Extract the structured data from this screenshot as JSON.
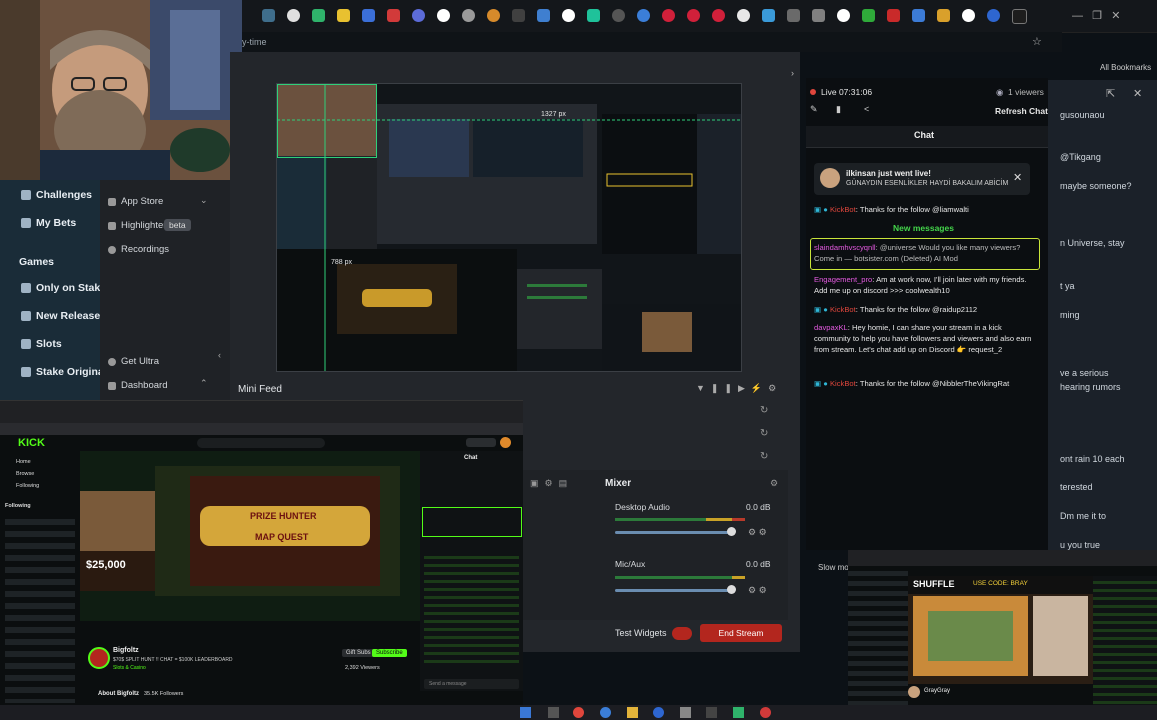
{
  "browser": {
    "url_fragment": "y-time",
    "all_bookmarks": "All Bookmarks"
  },
  "stake": {
    "challenges": "Challenges",
    "my_bets": "My Bets",
    "games": "Games",
    "only_on_stake": "Only on Stake",
    "new_releases": "New Releases",
    "slots": "Slots",
    "stake_originals": "Stake Originals"
  },
  "docks": {
    "app_store": "App Store",
    "highlighter": "Highlighter",
    "beta": "beta",
    "recordings": "Recordings",
    "get_ultra": "Get Ultra",
    "dashboard": "Dashboard"
  },
  "obs": {
    "preview_size_w": "1327 px",
    "preview_size_h": "788 px",
    "mini_feed": "Mini Feed",
    "mixer": "Mixer",
    "desktop_audio": "Desktop Audio",
    "desktop_db": "0.0 dB",
    "mic_aux": "Mic/Aux",
    "mic_db": "0.0 dB",
    "test_widgets": "Test Widgets",
    "end_stream": "End Stream"
  },
  "chat": {
    "live_time": "Live 07:31:06",
    "viewers": "1 viewers",
    "refresh": "Refresh Chat",
    "title": "Chat",
    "notif_title": "ilkinsan just went live!",
    "notif_body": "GÜNAYDIN ESENLİKLER HAYDİ BAKALIM ABİCİM",
    "new_messages": "New messages",
    "messages": [
      {
        "user": "KickBot",
        "text": ": Thanks for the follow @liamwalti"
      },
      {
        "user": "slaindamhvscyqnll",
        "text": ": @universe Would you like many viewers? Come in — botsister.com (Deleted) AI Mod"
      },
      {
        "user": "Engagement_pro",
        "text": ": Am at work now, I'll join later with my friends. Add me up on discord >>> coolwealth10"
      },
      {
        "user": "KickBot",
        "text": ": Thanks for the follow @raidup2112"
      },
      {
        "user": "davpaxKL",
        "text": ": Hey homie, I can share your stream in a kick community to help you have followers and viewers and also earn from stream. Let's chat add up on Discord 👉 request_2"
      },
      {
        "user": "KickBot",
        "text": ": Thanks for the follow @NibblerTheVikingRat"
      }
    ],
    "slow_mode": "Slow mo"
  },
  "right_bg": {
    "lines": [
      "gusounaou",
      "@Tikgang",
      "maybe someone?",
      "n Universe, stay",
      "t ya",
      "ming",
      "ve a serious",
      "hearing rumors",
      "ont rain 10 each",
      "terested",
      "Dm me it to",
      "u you true"
    ]
  },
  "kick": {
    "logo": "KICK",
    "nav": [
      "Home",
      "Browse",
      "Following"
    ],
    "following": "Following",
    "channel": "Bigfoltz",
    "stream_title": "$70$ SPLIT HUNT !! CHAT = $100K LEADERBOARD",
    "category": "Slots & Casino",
    "viewers": "2,392 Viewers",
    "about": "About Bigfoltz",
    "followers": "35.5K Followers",
    "chat": "Chat",
    "send_message": "Send a message",
    "win_amount": "$25,000",
    "game_title": "MAP QUEST",
    "prize": "PRIZE HUNTER",
    "gift_subs": "Gift Subs",
    "subscribe": "Subscribe"
  },
  "kick2": {
    "brand": "SHUFFLE",
    "code": "USE CODE: BRAY",
    "channel": "GrayGray"
  },
  "colors": {
    "kick_green": "#53fc18",
    "end_stream": "#b3261e",
    "chat_user_red": "#e0463c",
    "chat_user_pink": "#e45ae0",
    "new_messages": "#44d64b"
  }
}
